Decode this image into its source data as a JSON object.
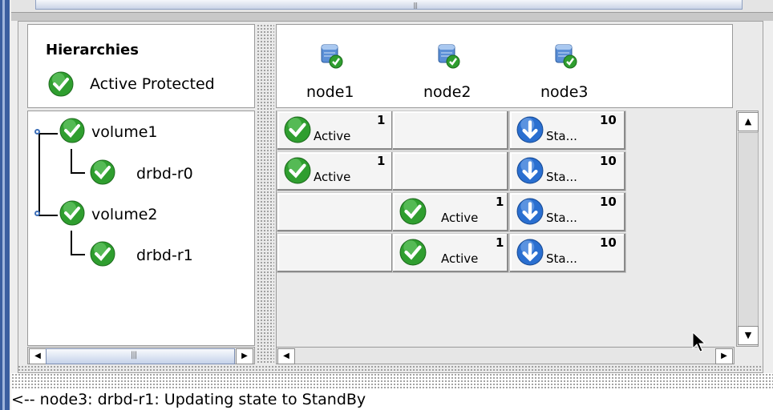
{
  "left_panel": {
    "title": "Hierarchies",
    "legend": {
      "label": "Active Protected",
      "icon": "check-circle-icon"
    },
    "tree": [
      {
        "label": "volume1",
        "icon": "check-circle-icon",
        "children": [
          {
            "label": "drbd-r0",
            "icon": "check-circle-icon"
          }
        ]
      },
      {
        "label": "volume2",
        "icon": "check-circle-icon",
        "children": [
          {
            "label": "drbd-r1",
            "icon": "check-circle-icon"
          }
        ]
      }
    ]
  },
  "nodes": [
    {
      "label": "node1",
      "icon": "server-check-icon"
    },
    {
      "label": "node2",
      "icon": "server-check-icon"
    },
    {
      "label": "node3",
      "icon": "server-check-icon"
    }
  ],
  "grid": {
    "rows": [
      {
        "node1": {
          "status": "Active",
          "priority": "1"
        },
        "node2": null,
        "node3": {
          "status": "Sta...",
          "priority": "10"
        }
      },
      {
        "node1": {
          "status": "Active",
          "priority": "1"
        },
        "node2": null,
        "node3": {
          "status": "Sta...",
          "priority": "10"
        }
      },
      {
        "node1": null,
        "node2": {
          "status": "Active",
          "priority": "1"
        },
        "node3": {
          "status": "Sta...",
          "priority": "10"
        }
      },
      {
        "node1": null,
        "node2": {
          "status": "Active",
          "priority": "1"
        },
        "node3": {
          "status": "Sta...",
          "priority": "10"
        }
      }
    ]
  },
  "status_bar": {
    "message": "<-- node3: drbd-r1: Updating state to StandBy"
  },
  "colors": {
    "active_green": "#2f9e2f",
    "standby_blue": "#2a6fd0",
    "frame_blue": "#3a5fa0"
  }
}
